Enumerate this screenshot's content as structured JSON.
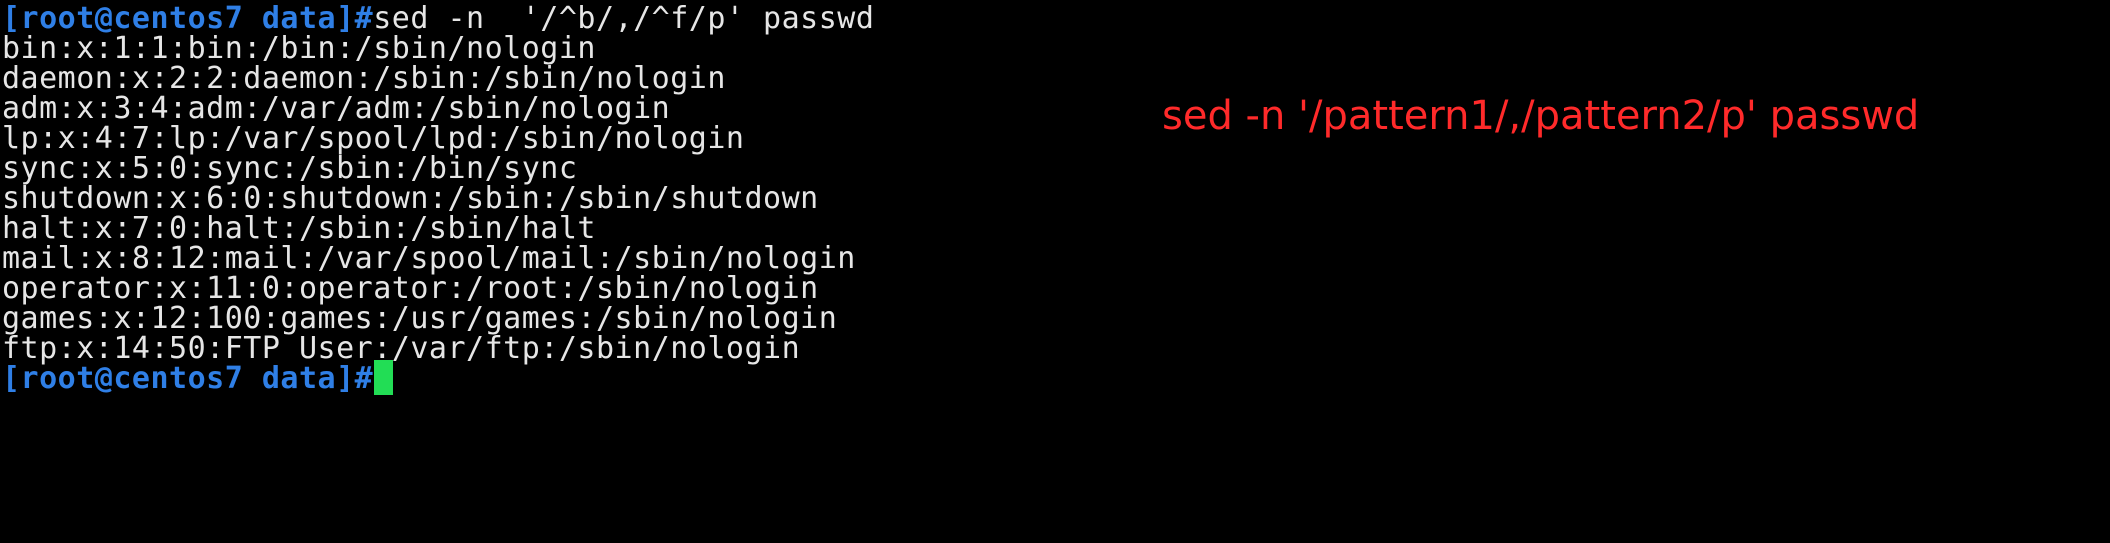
{
  "terminal": {
    "prompt": "[root@centos7 data]#",
    "command": "sed -n  '/^b/,/^f/p' passwd",
    "output_lines": [
      "bin:x:1:1:bin:/bin:/sbin/nologin",
      "daemon:x:2:2:daemon:/sbin:/sbin/nologin",
      "adm:x:3:4:adm:/var/adm:/sbin/nologin",
      "lp:x:4:7:lp:/var/spool/lpd:/sbin/nologin",
      "sync:x:5:0:sync:/sbin:/bin/sync",
      "shutdown:x:6:0:shutdown:/sbin:/sbin/shutdown",
      "halt:x:7:0:halt:/sbin:/sbin/halt",
      "mail:x:8:12:mail:/var/spool/mail:/sbin/nologin",
      "operator:x:11:0:operator:/root:/sbin/nologin",
      "games:x:12:100:games:/usr/games:/sbin/nologin",
      "ftp:x:14:50:FTP User:/var/ftp:/sbin/nologin"
    ],
    "final_prompt": "[root@centos7 data]#"
  },
  "annotation": {
    "text": "sed -n '/pattern1/,/pattern2/p' passwd"
  },
  "colors": {
    "background": "#000000",
    "prompt": "#2f7fe6",
    "text": "#e6e6e6",
    "cursor": "#22dd55",
    "annotation": "#ff2a2a"
  }
}
